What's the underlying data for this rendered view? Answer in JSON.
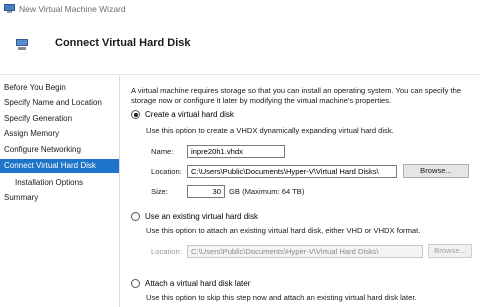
{
  "window": {
    "title": "New Virtual Machine Wizard"
  },
  "header": {
    "title": "Connect Virtual Hard Disk"
  },
  "sidebar": {
    "items": [
      {
        "label": "Before You Begin"
      },
      {
        "label": "Specify Name and Location"
      },
      {
        "label": "Specify Generation"
      },
      {
        "label": "Assign Memory"
      },
      {
        "label": "Configure Networking"
      },
      {
        "label": "Connect Virtual Hard Disk"
      },
      {
        "label": "Installation Options"
      },
      {
        "label": "Summary"
      }
    ],
    "active_index": 5
  },
  "main": {
    "intro": "A virtual machine requires storage so that you can install an operating system. You can specify the storage now or configure it later by modifying the virtual machine's properties.",
    "create": {
      "label": "Create a virtual hard disk",
      "description": "Use this option to create a VHDX dynamically expanding virtual hard disk.",
      "name_label": "Name:",
      "name_value": "inpre20h1.vhdx",
      "location_label": "Location:",
      "location_value": "C:\\Users\\Public\\Documents\\Hyper-V\\Virtual Hard Disks\\",
      "browse_label": "Browse...",
      "size_label": "Size:",
      "size_value": "30",
      "size_unit": "GB (Maximum: 64 TB)"
    },
    "existing": {
      "label": "Use an existing virtual hard disk",
      "description": "Use this option to attach an existing virtual hard disk, either VHD or VHDX format.",
      "location_label": "Location:",
      "location_value": "C:\\Users\\Public\\Documents\\Hyper-V\\Virtual Hard Disks\\",
      "browse_label": "Browse..."
    },
    "later": {
      "label": "Attach a virtual hard disk later",
      "description": "Use this option to skip this step now and attach an existing virtual hard disk later."
    }
  },
  "colors": {
    "accent": "#1d74c9"
  }
}
